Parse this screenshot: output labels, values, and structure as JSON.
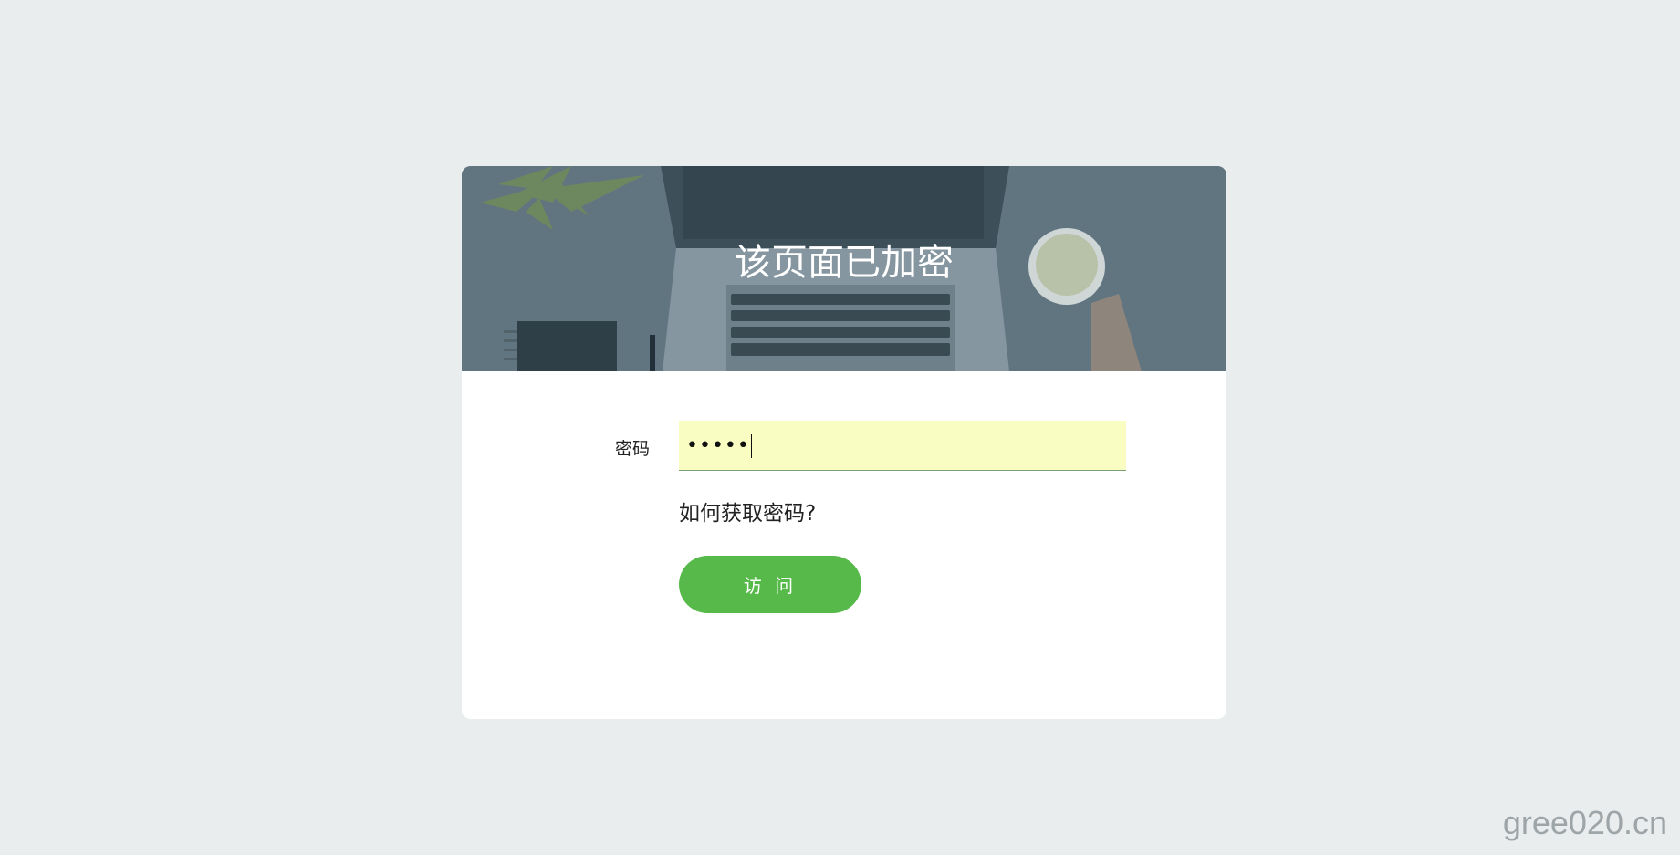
{
  "banner": {
    "title": "该页面已加密"
  },
  "form": {
    "password_label": "密码",
    "password_value": "•••••",
    "help_link": "如何获取密码?",
    "submit_label": "访 问"
  },
  "watermark": "gree020.cn",
  "colors": {
    "page_bg": "#e9edee",
    "banner_tint": "#5f7480",
    "input_bg": "#fafdc2",
    "button": "#57b94a"
  }
}
